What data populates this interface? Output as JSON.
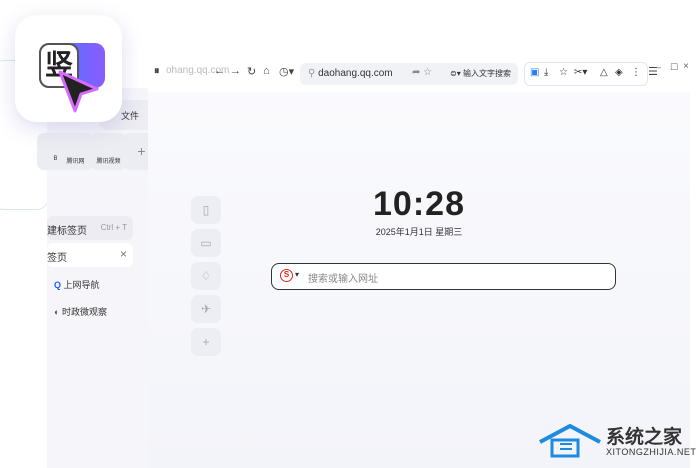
{
  "toolbar": {
    "tab_fragment": "ohang.qq.com",
    "url": "daohang.qq.com",
    "search_hint": "输入文字搜索"
  },
  "window_controls": {
    "minimize": "–",
    "maximize": "☐",
    "close": "×"
  },
  "clock": {
    "time": "10:28",
    "date": "2025年1月1日  星期三"
  },
  "search": {
    "placeholder": "搜索或输入网址"
  },
  "left_panel": {
    "file_label": "文件",
    "tiles": [
      "B",
      "腾讯网",
      "腾讯视频",
      "+"
    ],
    "menu": [
      {
        "label": "建标签页",
        "shortcut": "Ctrl + T"
      },
      {
        "label": "签页"
      },
      {
        "label": "上网导航"
      },
      {
        "label": "时政微观察"
      }
    ]
  },
  "app_icon": {
    "glyph": "竖"
  },
  "watermark": {
    "title": "系统之家",
    "url": "XITONGZHIJIA.NET"
  }
}
